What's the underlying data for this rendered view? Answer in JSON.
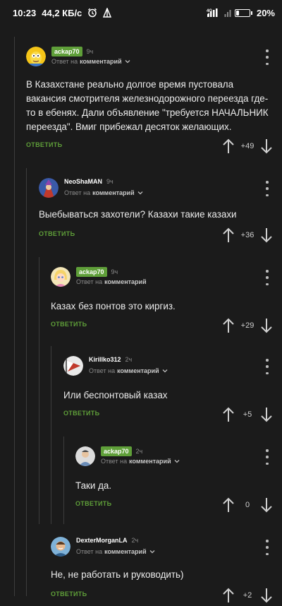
{
  "status_bar": {
    "time": "10:23",
    "speed": "44,2 КБ/с",
    "network": "4G",
    "battery": "20%",
    "battery_level": 0.2
  },
  "labels": {
    "reply_to": "Ответ на",
    "comment_word": "комментарий",
    "reply_button": "ОТВЕТИТЬ"
  },
  "comments": [
    {
      "author": "ackap70",
      "author_badge": true,
      "time": "9ч",
      "text": "В Казахстане реально долгое время пустовала вакансия смотрителя железнодорожного переезда где-то в ебенях. Дали объявление \"требуется НАЧАЛЬНИК переезда\". Вмиг прибежал десяток желающих.",
      "score": "+49",
      "avatar": "simpson-avatar"
    },
    {
      "author": "NeoShaMAN",
      "author_badge": false,
      "time": "9ч",
      "text": "Выебываться захотели? Казахи такие казахи",
      "score": "+36",
      "avatar": "wizard-avatar"
    },
    {
      "author": "ackap70",
      "author_badge": true,
      "time": "9ч",
      "text": "Казах без понтов это киргиз.",
      "score": "+29",
      "avatar": "cartoon-girl-avatar"
    },
    {
      "author": "Kirillko312",
      "author_badge": false,
      "time": "2ч",
      "text": "Или беспонтовый казах",
      "score": "+5",
      "avatar": "flag-avatar"
    },
    {
      "author": "ackap70",
      "author_badge": true,
      "time": "2ч",
      "text": "Таки да.",
      "score": "0",
      "avatar": "person-avatar"
    },
    {
      "author": "DexterMorganLA",
      "author_badge": false,
      "time": "2ч",
      "text": "Не, не работать и руководить)",
      "score": "+2",
      "avatar": "man-avatar"
    }
  ]
}
